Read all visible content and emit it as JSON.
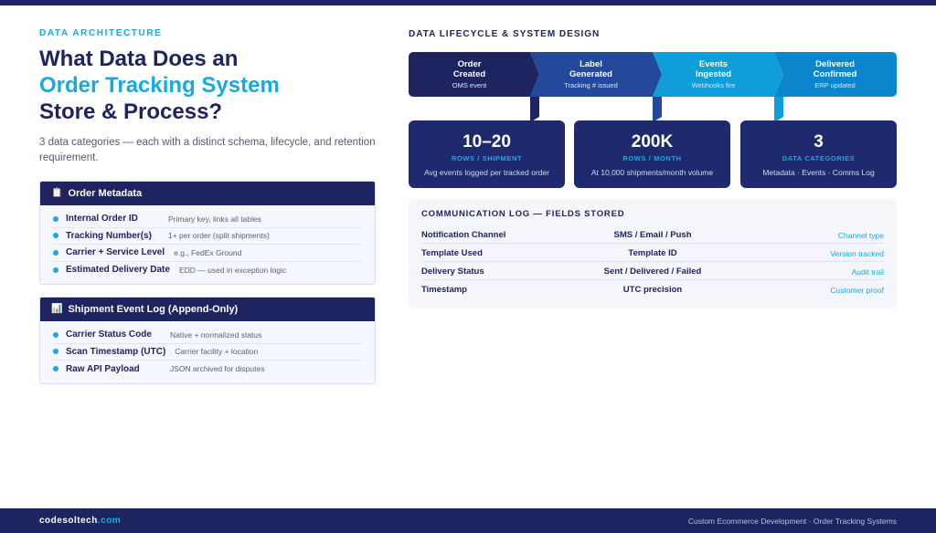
{
  "left": {
    "eyebrow": "DATA ARCHITECTURE",
    "title_line1": "What Data Does an",
    "title_line2": "Order Tracking System",
    "title_line3": "Store & Process?",
    "subtitle": "3 data categories — each with a distinct schema, lifecycle, and retention requirement.",
    "order_metadata": {
      "icon": "clipboard-icon",
      "icon_glyph": "📋",
      "heading": "Order Metadata",
      "rows": [
        {
          "label": "Internal Order ID",
          "desc": "Primary key, links all tables"
        },
        {
          "label": "Tracking Number(s)",
          "desc": "1+ per order (split shipments)"
        },
        {
          "label": "Carrier + Service Level",
          "desc": "e.g., FedEx Ground"
        },
        {
          "label": "Estimated Delivery Date",
          "desc": "EDD — used in exception logic"
        }
      ]
    },
    "shipment_log": {
      "icon": "bar-chart-icon",
      "icon_glyph": "📊",
      "heading": "Shipment Event Log (Append-Only)",
      "rows": [
        {
          "label": "Carrier Status Code",
          "desc": "Native + normalized status"
        },
        {
          "label": "Scan Timestamp (UTC)",
          "desc": "Carrier facility + location"
        },
        {
          "label": "Raw API Payload",
          "desc": "JSON archived for disputes"
        }
      ]
    }
  },
  "right": {
    "eyebrow": "DATA LIFECYCLE & SYSTEM DESIGN",
    "steps": [
      {
        "title1": "Order",
        "title2": "Created",
        "sub": "OMS event",
        "color": "#1e2460"
      },
      {
        "title1": "Label",
        "title2": "Generated",
        "sub": "Tracking # issued",
        "color": "#24499b"
      },
      {
        "title1": "Events",
        "title2": "Ingested",
        "sub": "Webhooks fire",
        "color": "#0f9ed9"
      },
      {
        "title1": "Delivered",
        "title2": "Confirmed",
        "sub": "ERP updated",
        "color": "#0b86cc"
      }
    ],
    "stats": [
      {
        "big": "10–20",
        "unit": "ROWS / SHIPMENT",
        "cap": "Avg events logged per tracked order"
      },
      {
        "big": "200K",
        "unit": "ROWS / MONTH",
        "cap": "At 10,000 shipments/month volume"
      },
      {
        "big": "3",
        "unit": "DATA CATEGORIES",
        "cap": "Metadata · Events · Comms Log"
      }
    ],
    "comm_log": {
      "title": "COMMUNICATION LOG — FIELDS STORED",
      "rows": [
        {
          "field": "Notification Channel",
          "value": "SMS / Email / Push",
          "note": "Channel type"
        },
        {
          "field": "Template Used",
          "value": "Template ID",
          "note": "Version tracked"
        },
        {
          "field": "Delivery Status",
          "value": "Sent / Delivered / Failed",
          "note": "Audit trail"
        },
        {
          "field": "Timestamp",
          "value": "UTC precision",
          "note": "Customer proof"
        }
      ]
    }
  },
  "footer": {
    "brand_main": "codesoltech",
    "brand_accent": ".com",
    "tagline": "Custom Ecommerce Development · Order Tracking Systems"
  }
}
